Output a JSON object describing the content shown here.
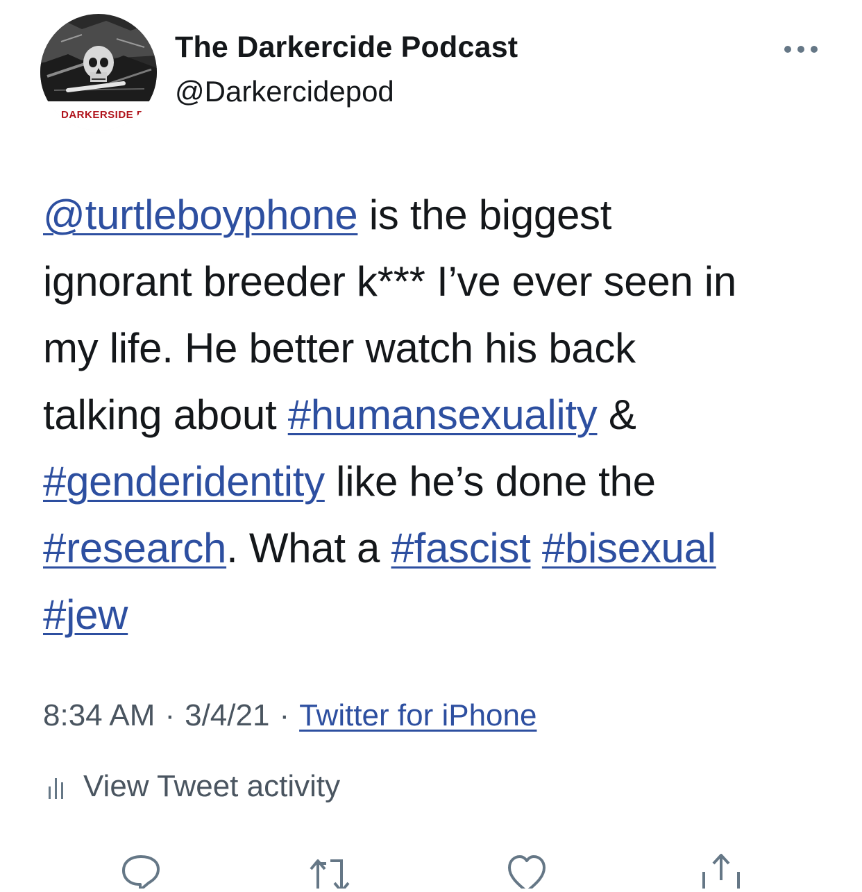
{
  "author": {
    "display_name": "The Darkercide Podcast",
    "handle": "@Darkercidepod",
    "avatar_banner_text": "DARKERSIDE PO"
  },
  "tweet": {
    "lines": [
      [
        {
          "text": "@turtleboyphone",
          "link": true
        },
        {
          "text": " is the biggest",
          "link": false
        }
      ],
      [
        {
          "text": "ignorant breeder k*** I’ve ever seen in",
          "link": false
        }
      ],
      [
        {
          "text": "my life. He better watch his back",
          "link": false
        }
      ],
      [
        {
          "text": "talking about ",
          "link": false
        },
        {
          "text": "#humansexuality",
          "link": true
        },
        {
          "text": " &",
          "link": false
        }
      ],
      [
        {
          "text": "#genderidentity",
          "link": true
        },
        {
          "text": " like he’s done the",
          "link": false
        }
      ],
      [
        {
          "text": "#research",
          "link": true
        },
        {
          "text": ".  What a ",
          "link": false
        },
        {
          "text": "#fascist",
          "link": true
        },
        {
          "text": " ",
          "link": false
        },
        {
          "text": "#bisexual",
          "link": true
        }
      ],
      [
        {
          "text": "#jew",
          "link": true
        }
      ]
    ]
  },
  "meta": {
    "time": "8:34 AM",
    "separator": "·",
    "date": "3/4/21",
    "source": "Twitter for iPhone"
  },
  "activity": {
    "label": "View Tweet activity",
    "icon": "bar-chart-icon"
  },
  "actions": [
    {
      "name": "reply-button",
      "icon": "reply-icon"
    },
    {
      "name": "retweet-button",
      "icon": "retweet-icon"
    },
    {
      "name": "like-button",
      "icon": "heart-icon"
    },
    {
      "name": "share-button",
      "icon": "share-icon"
    }
  ],
  "colors": {
    "link": "#2d4fa0",
    "text": "#14171a",
    "muted": "#4a5560",
    "icon": "#657786",
    "avatar_banner": "#b0121a"
  }
}
